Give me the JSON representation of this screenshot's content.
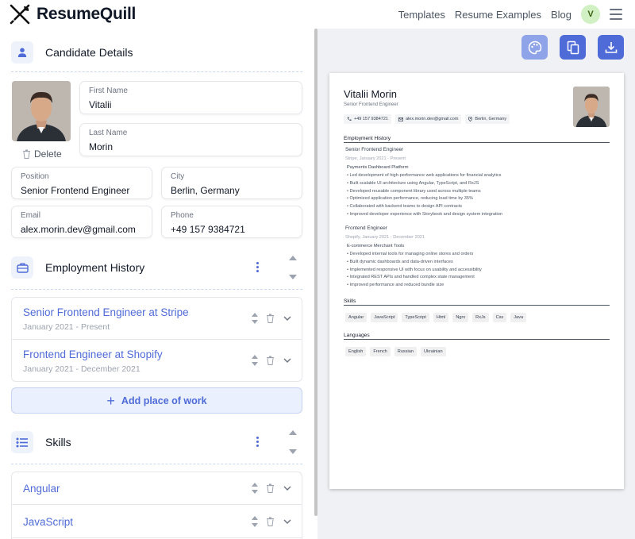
{
  "app": {
    "name": "ResumeQuill"
  },
  "nav": {
    "links": [
      "Templates",
      "Resume Examples",
      "Blog"
    ],
    "user_initial": "V"
  },
  "candidate": {
    "section_title": "Candidate Details",
    "delete_label": "Delete",
    "first_name": {
      "label": "First Name",
      "value": "Vitalii"
    },
    "last_name": {
      "label": "Last Name",
      "value": "Morin"
    },
    "position": {
      "label": "Position",
      "value": "Senior Frontend Engineer"
    },
    "city": {
      "label": "City",
      "value": "Berlin, Germany"
    },
    "email": {
      "label": "Email",
      "value": "alex.morin.dev@gmail.com"
    },
    "phone": {
      "label": "Phone",
      "value": "+49 157 9384721"
    }
  },
  "employment": {
    "section_title": "Employment History",
    "items": [
      {
        "title": "Senior Frontend Engineer at Stripe",
        "dates": "January 2021 - Present"
      },
      {
        "title": "Frontend Engineer at Shopify",
        "dates": "January 2021 - December 2021"
      }
    ],
    "add_label": "Add place of work"
  },
  "skills": {
    "section_title": "Skills",
    "items": [
      "Angular",
      "JavaScript"
    ]
  },
  "preview": {
    "name": "Vitalii Morin",
    "role": "Senior Frontend Engineer",
    "phone": "+49 157 9384721",
    "email": "alex.morin.dev@gmail.com",
    "location": "Berlin, Germany",
    "employment_heading": "Employment History",
    "jobs": [
      {
        "title": "Senior Frontend Engineer",
        "sub": "Stripe, January 2021 - Present",
        "project": "Payments Dashboard Platform",
        "bullets": [
          "• Led development of high-performance web applications for financial analytics",
          "• Built scalable UI architecture using Angular, TypeScript, and RxJS",
          "• Developed reusable component library used across multiple teams",
          "• Optimized application performance, reducing load time by 35%",
          "• Collaborated with backend teams to design API contracts",
          "• Improved developer experience with Storybook and design system integration"
        ]
      },
      {
        "title": "Frontend Engineer",
        "sub": "Shopify, January 2021 - December 2021",
        "project": "E-commerce Merchant Tools",
        "bullets": [
          "• Developed internal tools for managing online stores and orders",
          "• Built dynamic dashboards and data-driven interfaces",
          "• Implemented responsive UI with focus on usability and accessibility",
          "• Integrated REST APIs and handled complex state management",
          "• Improved performance and reduced bundle size"
        ]
      }
    ],
    "skills_heading": "Skills",
    "skills": [
      "Angular",
      "JavaScript",
      "TypeScript",
      "Html",
      "Ngrx",
      "RxJs",
      "Css",
      "Java"
    ],
    "languages_heading": "Languages",
    "languages": [
      "English",
      "French",
      "Russian",
      "Ukrainian"
    ]
  },
  "colors": {
    "accent": "#4f6bd8",
    "accent_light": "#eaf0fd",
    "palette_button": "#8fa3e8",
    "panel_bg": "#f0f1f4"
  }
}
